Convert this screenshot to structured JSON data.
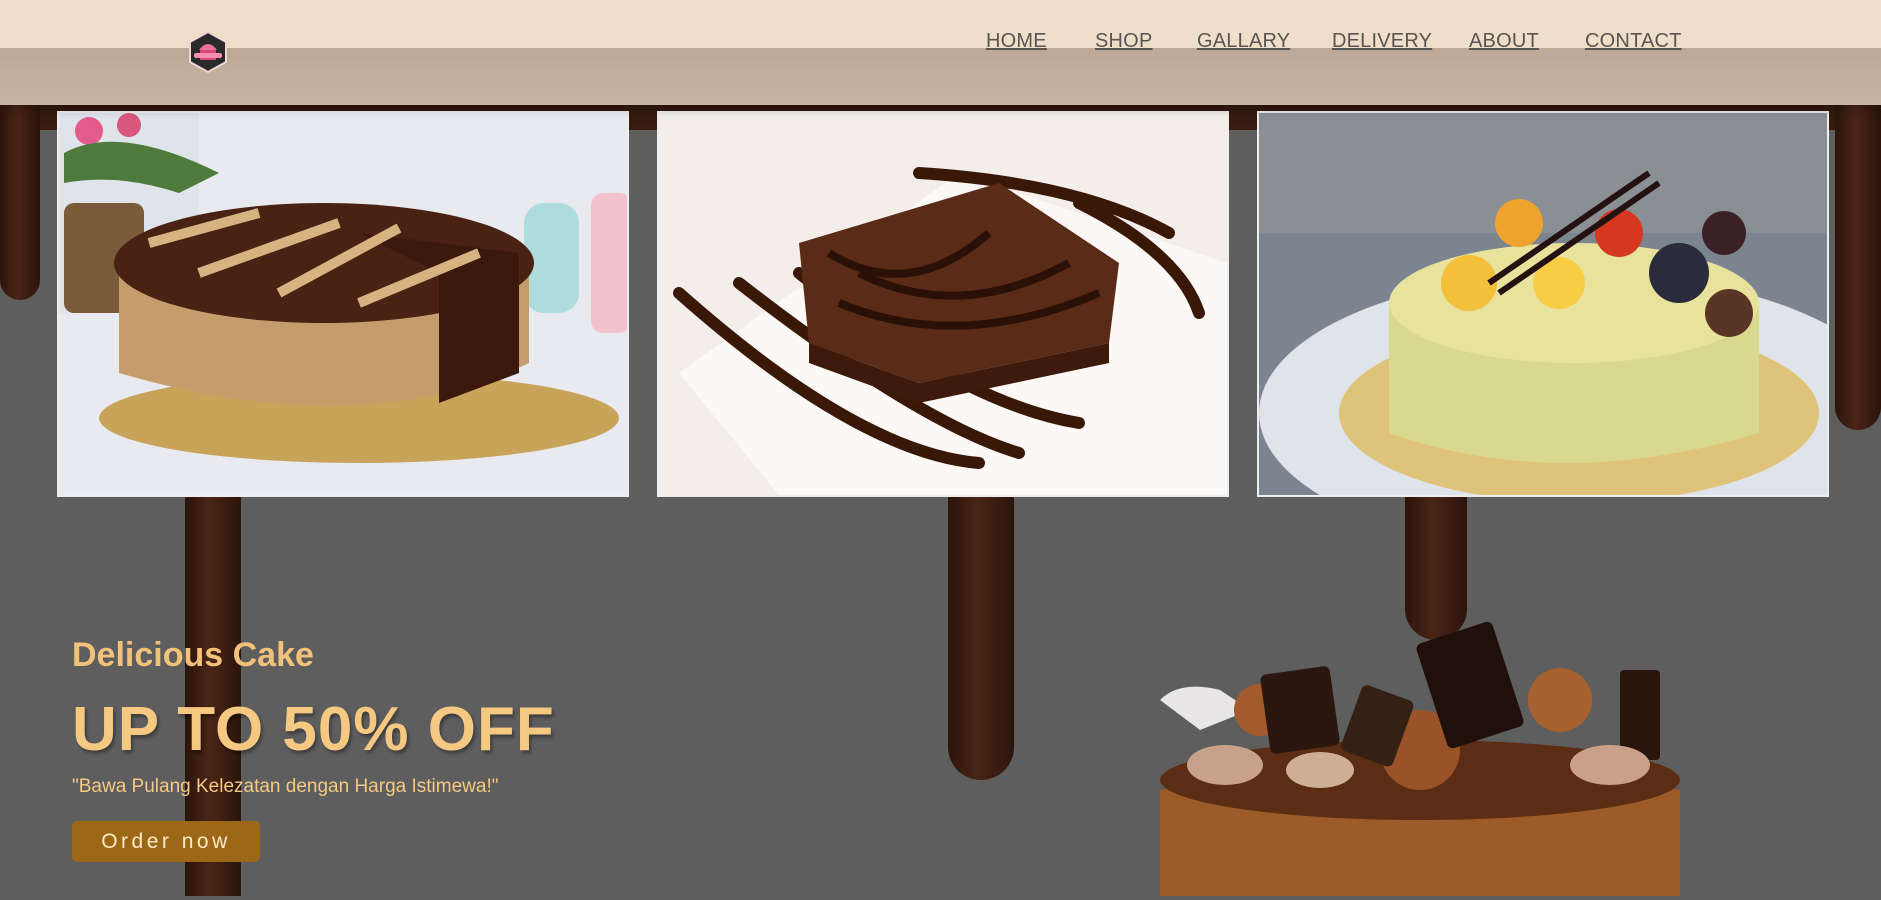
{
  "header": {
    "logo_icon": "cupcake-badge-logo",
    "nav": [
      {
        "label": "HOME"
      },
      {
        "label": "SHOP"
      },
      {
        "label": "GALLARY"
      },
      {
        "label": "DELIVERY"
      },
      {
        "label": "ABOUT"
      },
      {
        "label": "CONTACT"
      }
    ]
  },
  "gallery": {
    "images": [
      {
        "icon": "chocolate-cake-image"
      },
      {
        "icon": "brownie-image"
      },
      {
        "icon": "fruit-cheesecake-image"
      }
    ]
  },
  "hero": {
    "subtitle": "Delicious Cake",
    "title": "UP TO 50% OFF",
    "tagline": "\"Bawa Pulang Kelezatan dengan Harga Istimewa!\"",
    "cta_label": "Order now",
    "image_icon": "chocolate-truffle-cake-image"
  },
  "colors": {
    "background": "#5e5e5e",
    "header_top": "#efdfca",
    "header_bottom": "#bda898",
    "accent_text": "#f6c983",
    "button": "#9c6818"
  }
}
